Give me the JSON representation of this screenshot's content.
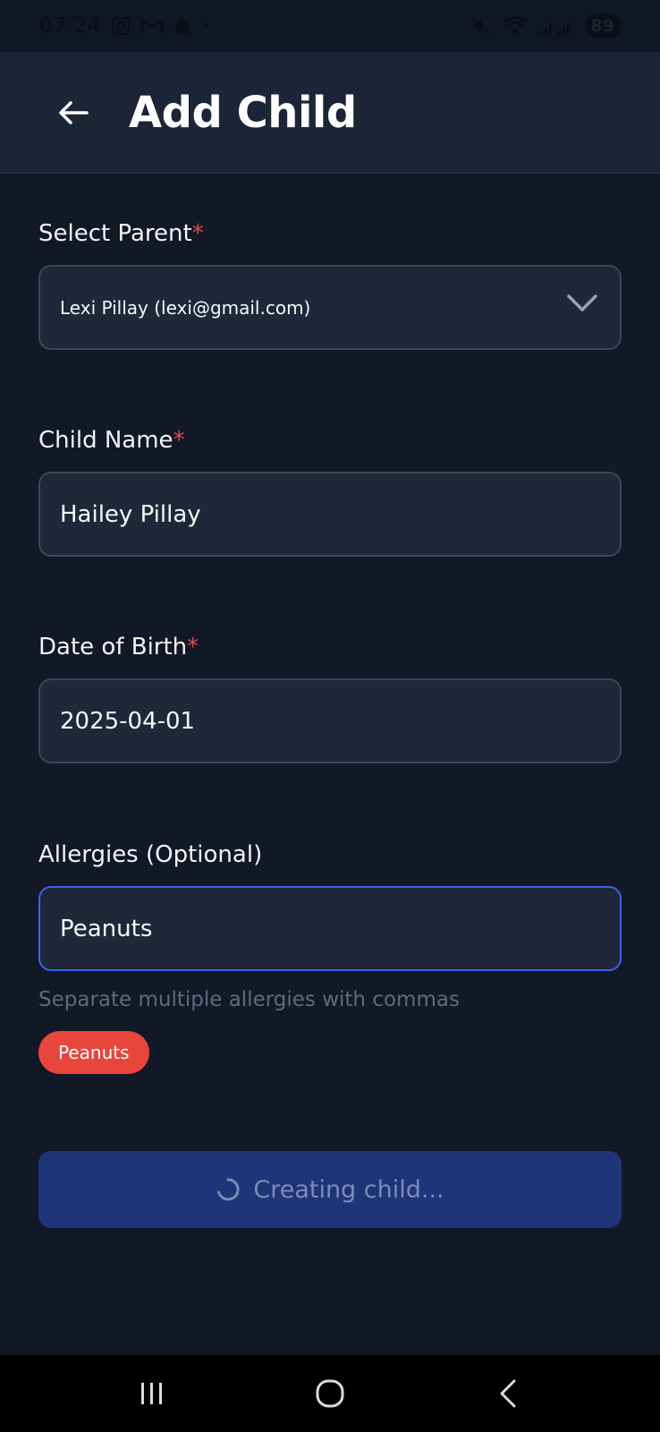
{
  "status_bar": {
    "time": "07:24",
    "battery": "89"
  },
  "header": {
    "title": "Add Child"
  },
  "form": {
    "parent": {
      "label": "Select Parent",
      "required_mark": "*",
      "value": "Lexi Pillay (lexi@gmail.com)"
    },
    "child_name": {
      "label": "Child Name",
      "required_mark": "*",
      "value": "Hailey Pillay"
    },
    "dob": {
      "label": "Date of Birth",
      "required_mark": "*",
      "value": "2025-04-01"
    },
    "allergies": {
      "label": "Allergies (Optional)",
      "value": "Peanuts",
      "helper": "Separate multiple allergies with commas",
      "chips": [
        "Peanuts"
      ]
    },
    "submit_label": "Creating child..."
  },
  "colors": {
    "background": "#121826",
    "app_bar": "#1c2535",
    "input_bg": "#1f2838",
    "focus_border": "#3d63e8",
    "required": "#e34b4b",
    "chip": "#e8453c",
    "button": "#1f3479"
  },
  "icons": {
    "back": "arrow-left-icon",
    "dropdown": "chevron-down-icon",
    "spinner": "loading-spinner-icon"
  }
}
